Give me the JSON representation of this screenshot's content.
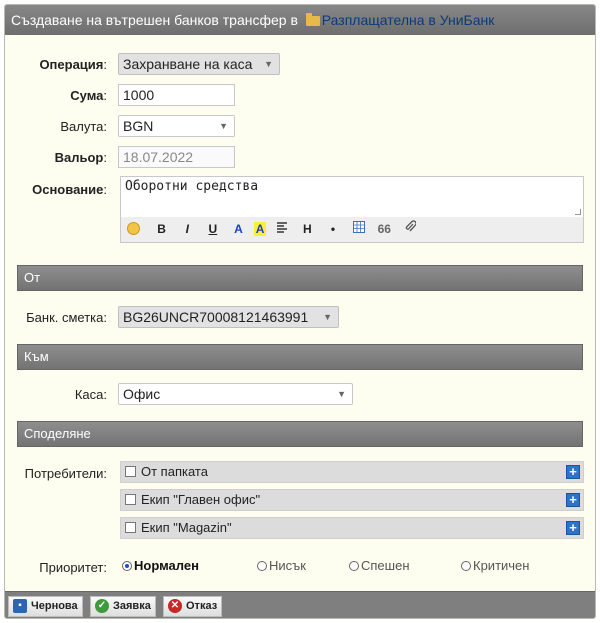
{
  "window": {
    "title_prefix": "Създаване на вътрешен банков трансфер в",
    "title_link": "Разплащателна в УниБанк"
  },
  "form": {
    "operation": {
      "label": "Операция",
      "value": "Захранване на каса"
    },
    "amount": {
      "label": "Сума",
      "value": "1000"
    },
    "currency": {
      "label": "Валута:",
      "value": "BGN"
    },
    "valor": {
      "label": "Вальор",
      "value": "18.07.2022"
    },
    "reason": {
      "label": "Основание",
      "value": "Оборотни средства"
    },
    "colon": ":"
  },
  "editor_toolbar": {
    "bold": "B",
    "italic": "I",
    "underline": "U",
    "font_color": "A",
    "highlight": "A",
    "heading": "H",
    "bullet": "•",
    "quote": "66"
  },
  "sections": {
    "from": {
      "title": "От",
      "account_label": "Банк. сметка:",
      "account_value": "BG26UNCR70008121463991"
    },
    "to": {
      "title": "Към",
      "cash_label": "Каса:",
      "cash_value": "Офис"
    },
    "sharing": {
      "title": "Споделяне",
      "users_label": "Потребители:"
    }
  },
  "users": [
    {
      "label": "От папката"
    },
    {
      "label": "Екип \"Главен офис\""
    },
    {
      "label": "Екип \"Magazin\""
    }
  ],
  "priority": {
    "label": "Приоритет:",
    "options": [
      "Нормален",
      "Нисък",
      "Спешен",
      "Критичен"
    ],
    "selected": "Нормален"
  },
  "footer": {
    "draft": "Чернова",
    "request": "Заявка",
    "cancel": "Отказ"
  },
  "icons": {
    "folder": "folder-icon",
    "save": "save-icon",
    "check": "check-icon",
    "cancel": "cancel-icon",
    "plus": "plus-icon"
  },
  "colors": {
    "header": "#7a7a7a",
    "link": "#0a3a7a",
    "panel": "#fdfdf0",
    "accent_blue": "#2d74c8"
  }
}
